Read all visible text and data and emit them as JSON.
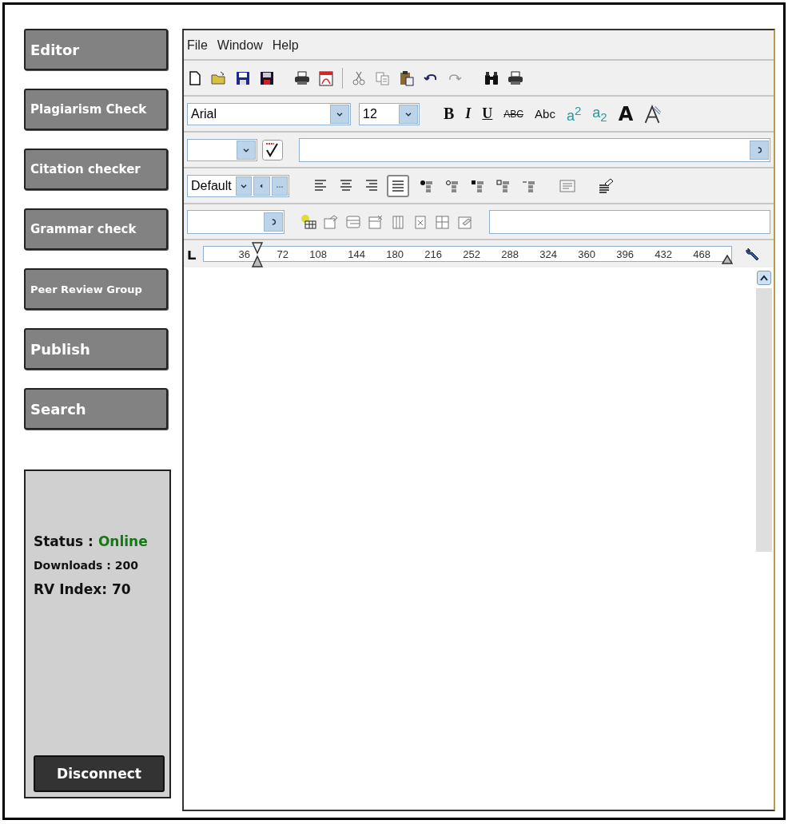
{
  "sidebar": {
    "items": [
      {
        "label": "Editor",
        "kind": "large"
      },
      {
        "label": "Plagiarism Check",
        "kind": "small"
      },
      {
        "label": "Citation checker",
        "kind": "small"
      },
      {
        "label": "Grammar check",
        "kind": "small"
      },
      {
        "label": "Peer Review Group",
        "kind": "tiny"
      },
      {
        "label": "Publish",
        "kind": "large"
      },
      {
        "label": "Search",
        "kind": "large"
      }
    ]
  },
  "status_panel": {
    "status_label": "Status :",
    "status_value": "Online",
    "downloads": "Downloads : 200",
    "rv_index": "RV Index: 70",
    "button": "Disconnect"
  },
  "editor": {
    "menu": [
      "File",
      "Window",
      "Help"
    ],
    "font": {
      "family": "Arial",
      "size": "12"
    },
    "format_buttons": [
      {
        "label": "B",
        "kind": "bold"
      },
      {
        "label": "I",
        "kind": "italic"
      },
      {
        "label": "U",
        "kind": "underline"
      },
      {
        "label": "ABC",
        "kind": "strike"
      },
      {
        "label": "Abc",
        "kind": "caps"
      },
      {
        "label": "a$^{2}$",
        "kind": "script"
      },
      {
        "label": "a$_{2}$",
        "kind": "script"
      },
      {
        "label": "A",
        "kind": "heavy"
      }
    ],
    "style": "Default",
    "alignment": [
      {
        "selected": false
      },
      {
        "selected": false
      },
      {
        "selected": false
      },
      {
        "selected": true
      }
    ],
    "ruler": [
      "36",
      "72",
      "108",
      "144",
      "180",
      "216",
      "252",
      "288",
      "324",
      "360",
      "396",
      "432",
      "468"
    ]
  }
}
